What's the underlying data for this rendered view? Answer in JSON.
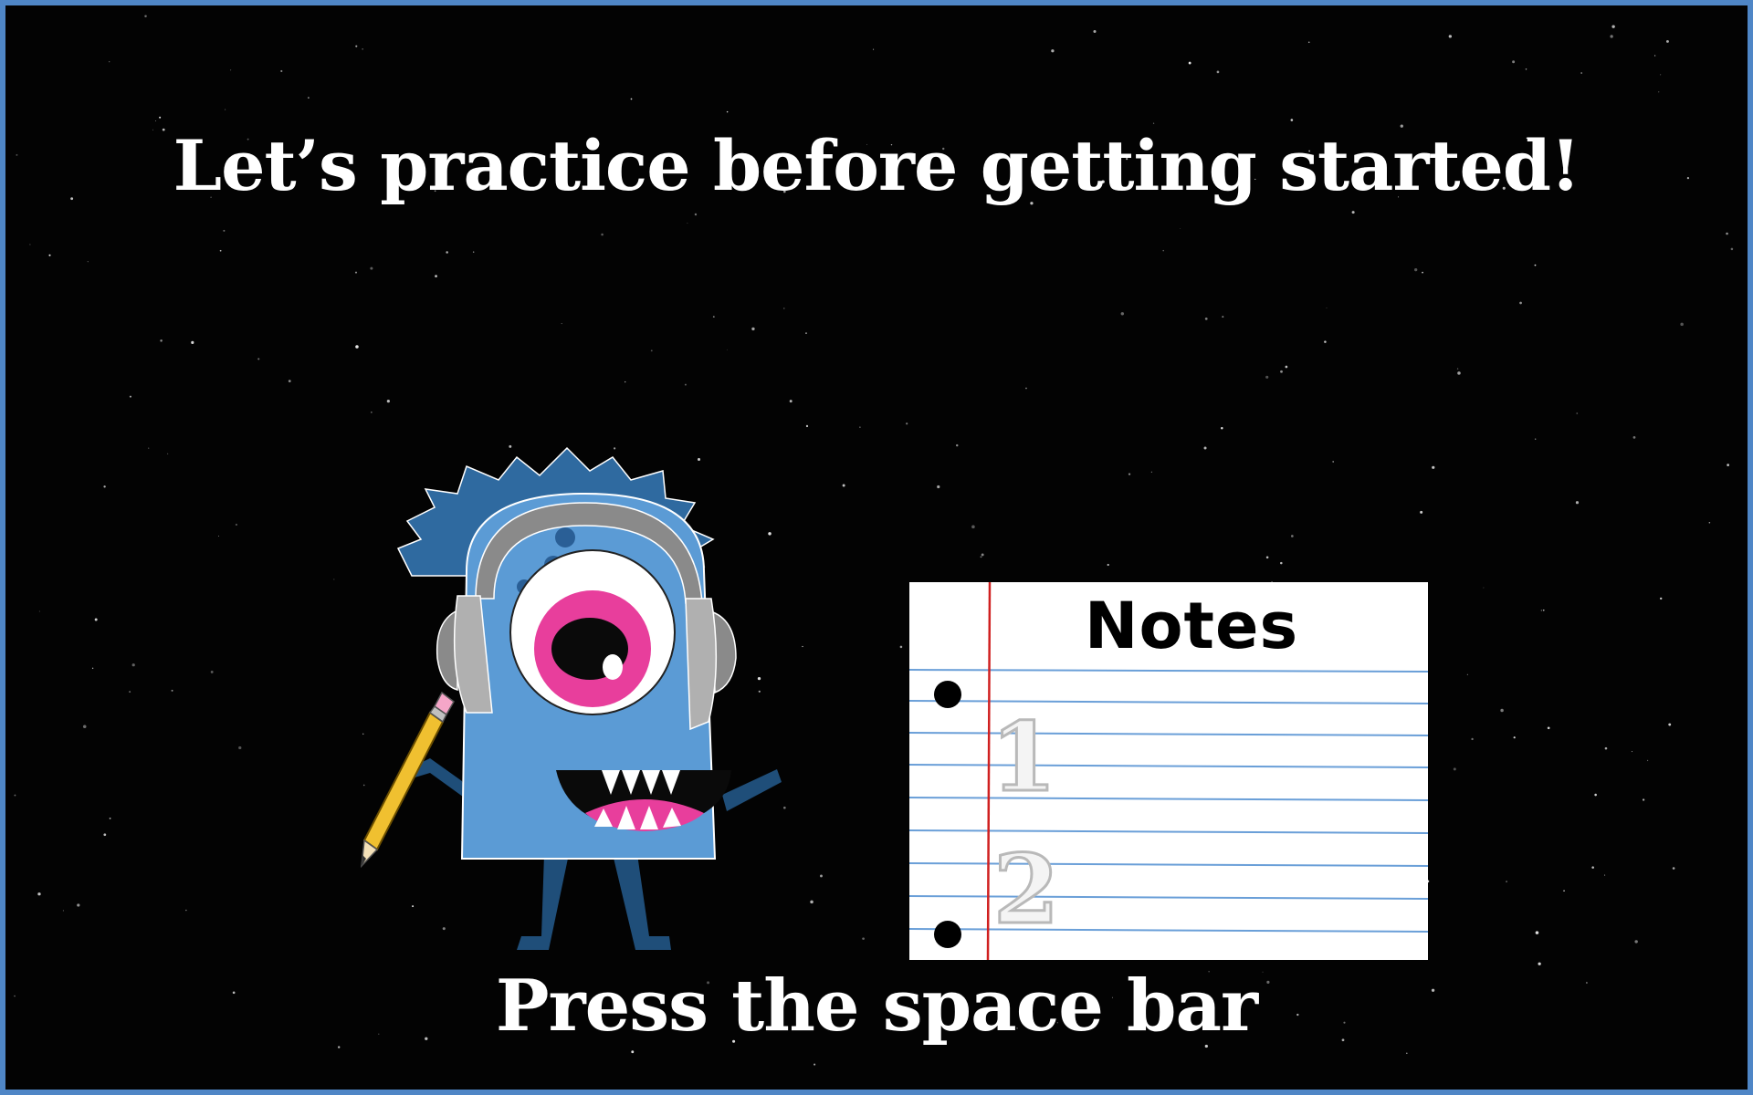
{
  "screen": {
    "title": "Let’s practice before getting started!",
    "prompt": "Press the space bar"
  },
  "notepad": {
    "heading": "Notes",
    "numbers": [
      "1",
      "2"
    ]
  },
  "colors": {
    "border": "#4f86c6",
    "background": "#030303",
    "monster_body": "#5b9bd5",
    "monster_dark": "#1f4e79",
    "headphones": "#8a8a8a",
    "eye_iris": "#e83e9c",
    "pencil": "#f0c030",
    "notepad_line": "#6a9fd8",
    "notepad_margin": "#d02020"
  }
}
